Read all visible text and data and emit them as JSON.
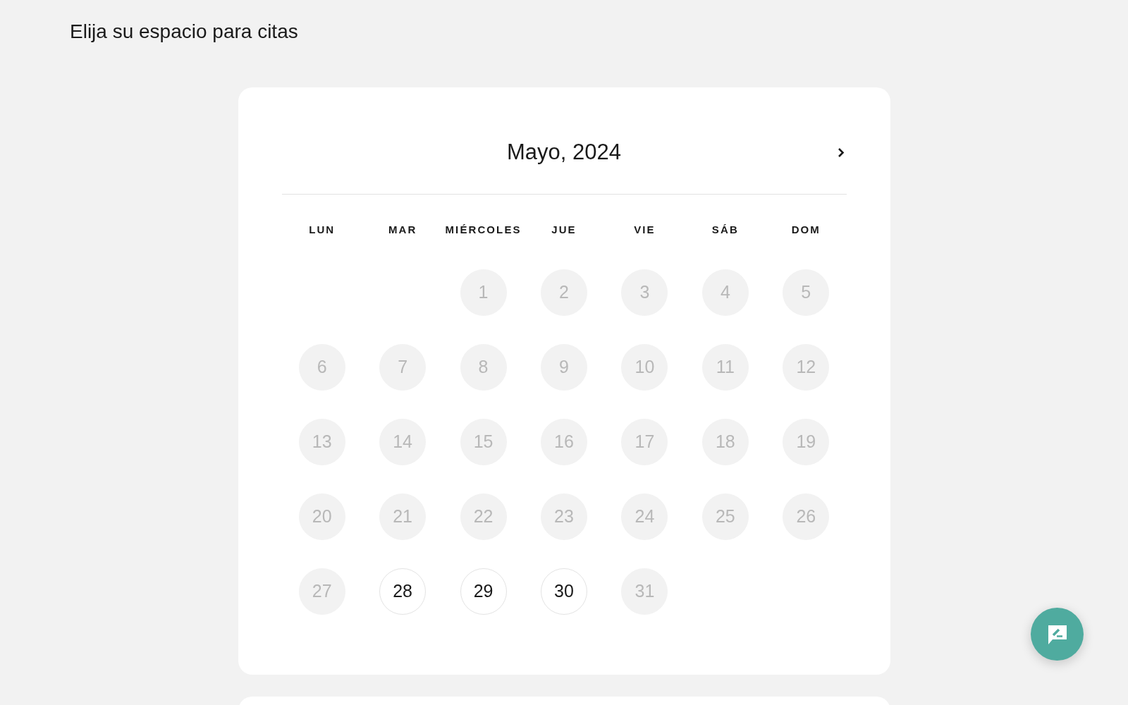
{
  "page": {
    "title": "Elija su espacio para citas"
  },
  "calendar": {
    "month_label": "Mayo, 2024",
    "weekdays": [
      "LUN",
      "MAR",
      "MIÉRCOLES",
      "JUE",
      "VIE",
      "SÁB",
      "DOM"
    ],
    "weeks": [
      [
        {
          "label": "1",
          "disabled": true
        },
        {
          "label": "2",
          "disabled": true
        },
        {
          "label": "3",
          "disabled": true
        },
        {
          "label": "4",
          "disabled": true
        },
        {
          "label": "5",
          "disabled": true
        }
      ],
      [
        {
          "label": "6",
          "disabled": true
        },
        {
          "label": "7",
          "disabled": true
        },
        {
          "label": "8",
          "disabled": true
        },
        {
          "label": "9",
          "disabled": true
        },
        {
          "label": "10",
          "disabled": true
        },
        {
          "label": "11",
          "disabled": true
        },
        {
          "label": "12",
          "disabled": true
        }
      ],
      [
        {
          "label": "13",
          "disabled": true
        },
        {
          "label": "14",
          "disabled": true
        },
        {
          "label": "15",
          "disabled": true
        },
        {
          "label": "16",
          "disabled": true
        },
        {
          "label": "17",
          "disabled": true
        },
        {
          "label": "18",
          "disabled": true
        },
        {
          "label": "19",
          "disabled": true
        }
      ],
      [
        {
          "label": "20",
          "disabled": true
        },
        {
          "label": "21",
          "disabled": true
        },
        {
          "label": "22",
          "disabled": true
        },
        {
          "label": "23",
          "disabled": true
        },
        {
          "label": "24",
          "disabled": true
        },
        {
          "label": "25",
          "disabled": true
        },
        {
          "label": "26",
          "disabled": true
        }
      ],
      [
        {
          "label": "27",
          "disabled": true
        },
        {
          "label": "28",
          "disabled": false
        },
        {
          "label": "29",
          "disabled": false
        },
        {
          "label": "30",
          "disabled": false
        },
        {
          "label": "31",
          "disabled": true
        }
      ]
    ]
  }
}
